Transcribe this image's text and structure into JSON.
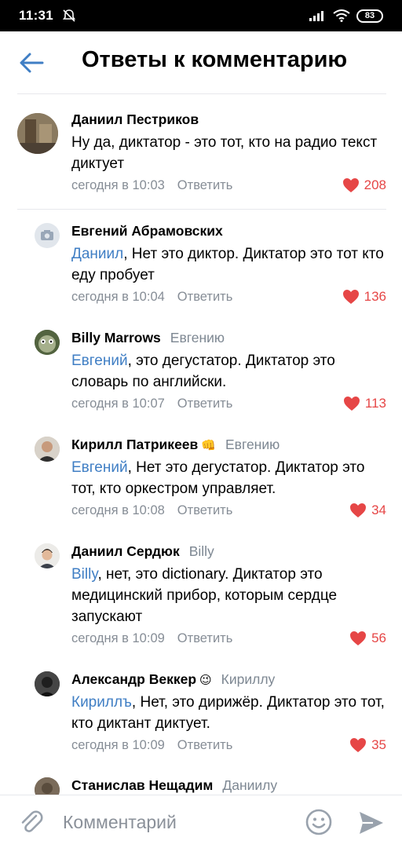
{
  "status_bar": {
    "time": "11:31",
    "battery": "83"
  },
  "header": {
    "title": "Ответы к комментарию"
  },
  "comments": [
    {
      "author": "Даниил Пестриков",
      "reply_to": "",
      "mention": "",
      "text": "Ну да, диктатор - это тот, кто на радио текст диктует",
      "date": "сегодня в 10:03",
      "reply_label": "Ответить",
      "likes": "208"
    },
    {
      "author": "Евгений Абрамовских",
      "reply_to": "",
      "mention": "Даниил",
      "text": ", Нет это диктор. Диктатор это тот кто еду пробует",
      "date": "сегодня в 10:04",
      "reply_label": "Ответить",
      "likes": "136"
    },
    {
      "author": "Billy Marrows",
      "reply_to": "Евгению",
      "mention": "Евгений",
      "text": ", это дегустатор. Диктатор это словарь по английски.",
      "date": "сегодня в 10:07",
      "reply_label": "Ответить",
      "likes": "113"
    },
    {
      "author": "Кирилл Патрикеев",
      "emoji": "👊",
      "reply_to": "Евгению",
      "mention": "Евгений",
      "text": ", Нет это дегустатор. Диктатор это тот, кто оркестром управляет.",
      "date": "сегодня в 10:08",
      "reply_label": "Ответить",
      "likes": "34"
    },
    {
      "author": "Даниил Сердюк",
      "reply_to": "Billy",
      "mention": "Billy",
      "text": ", нет, это dictionary. Диктатор это медицинский прибор, которым сердце запускают",
      "date": "сегодня в 10:09",
      "reply_label": "Ответить",
      "likes": "56"
    },
    {
      "author": "Александр Веккер",
      "emoji": "😉",
      "reply_to": "Кириллу",
      "mention": "Кириллъ",
      "text": ", Нет, это дирижёр. Диктатор это тот, кто диктант диктует.",
      "date": "сегодня в 10:09",
      "reply_label": "Ответить",
      "likes": "35"
    },
    {
      "author": "Станислав Нещадим",
      "reply_to": "Даниилу"
    }
  ],
  "composer": {
    "placeholder": "Комментарий"
  },
  "colors": {
    "accent": "#3f7ec4",
    "like": "#e64646",
    "meta": "#868d96"
  }
}
